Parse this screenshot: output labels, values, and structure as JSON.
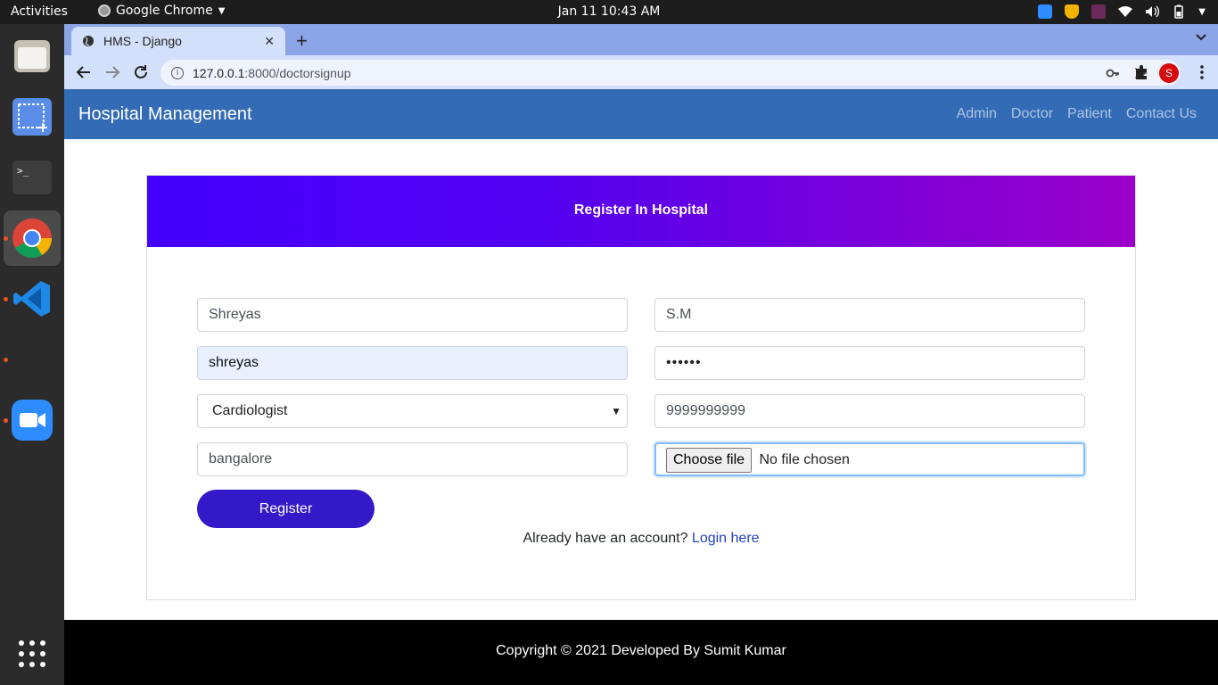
{
  "topbar": {
    "activities": "Activities",
    "app_name": "Google Chrome",
    "clock": "Jan 11  10:43 AM"
  },
  "browser": {
    "tab_title": "HMS - Django",
    "url_host": "127.0.0.1",
    "url_path": ":8000/doctorsignup",
    "profile_initial": "S"
  },
  "navbar": {
    "brand": "Hospital Management",
    "links": [
      "Admin",
      "Doctor",
      "Patient",
      "Contact Us"
    ]
  },
  "form": {
    "header": "Register In Hospital",
    "first_name": "Shreyas",
    "last_name": "S.M",
    "username": "shreyas",
    "password_masked": "••••••",
    "department": "Cardiologist",
    "mobile": "9999999999",
    "address": "bangalore",
    "file_button": "Choose file",
    "file_status": "No file chosen",
    "register_label": "Register",
    "already_text": "Already have an account?",
    "login_link": "Login here"
  },
  "footer": {
    "text": "Copyright © 2021 Developed By Sumit Kumar"
  },
  "colors": {
    "navbar": "#346bb6",
    "card_header_start": "#4400ff",
    "card_header_end": "#9b00c8",
    "register_button": "#3319c8",
    "footer": "#000000"
  }
}
